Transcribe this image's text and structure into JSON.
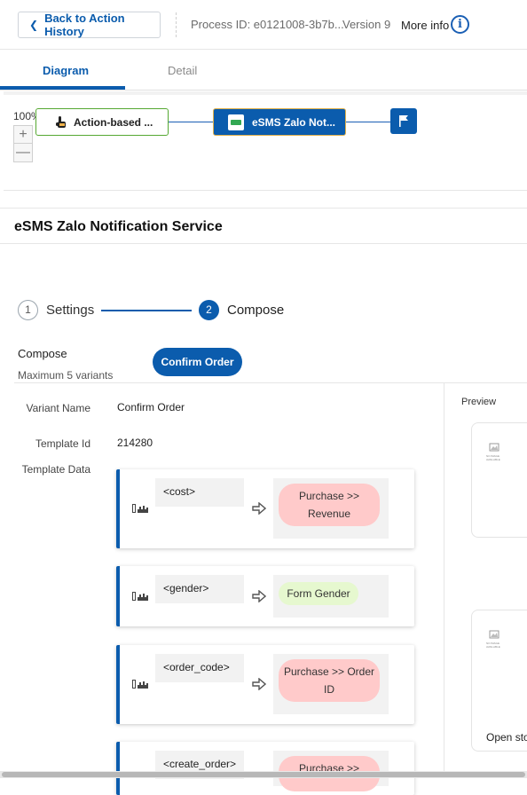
{
  "header": {
    "back_label": "Back to Action History",
    "process_id": "Process ID: e0121008-3b7b...",
    "version": "Version 9",
    "more_info": "More info",
    "info_icon": "info-icon"
  },
  "tabs": [
    {
      "label": "Diagram",
      "active": true
    },
    {
      "label": "Detail",
      "active": false
    }
  ],
  "diagram": {
    "zoom": "100%",
    "zoom_in": "+",
    "zoom_out": "—",
    "nodes": [
      {
        "label": "Action-based ...",
        "icon": "hand-pointer-icon"
      },
      {
        "label": "eSMS Zalo Not...",
        "icon": "esms-logo-icon"
      },
      {
        "label": "",
        "icon": "flag-icon"
      }
    ]
  },
  "service_title": "eSMS Zalo Notification Service",
  "stepper": {
    "steps": [
      {
        "number": "1",
        "label": "Settings",
        "active": false
      },
      {
        "number": "2",
        "label": "Compose",
        "active": true
      }
    ]
  },
  "compose": {
    "label": "Compose",
    "max_label": "Maximum 5 variants",
    "variant": "Confirm Order"
  },
  "fields": {
    "variant_name_label": "Variant Name",
    "variant_name_value": "Confirm Order",
    "template_id_label": "Template Id",
    "template_id_value": "214280",
    "template_data_label": "Template Data"
  },
  "mappings": [
    {
      "key": "<cost>",
      "value_line1": "Purchase >>",
      "value_line2": "Revenue",
      "color": "#ffcaca"
    },
    {
      "key": "<gender>",
      "value_line1": "Form Gender",
      "value_line2": "",
      "color": "#e6f8cf"
    },
    {
      "key": "<order_code>",
      "value_line1": "Purchase >> Order",
      "value_line2": "ID",
      "color": "#ffcaca"
    },
    {
      "key": "<create_order>",
      "value_line1": "Purchase >>",
      "value_line2": "",
      "color": "#ffcaca"
    }
  ],
  "preview": {
    "label": "Preview",
    "image_placeholder": "NO IMAGE AVAILABLE",
    "open_label": "Open sto"
  },
  "colors": {
    "primary": "#0b5cad",
    "node_border_green": "#55a832",
    "pill_red": "#ffcaca",
    "pill_green": "#e6f8cf"
  }
}
